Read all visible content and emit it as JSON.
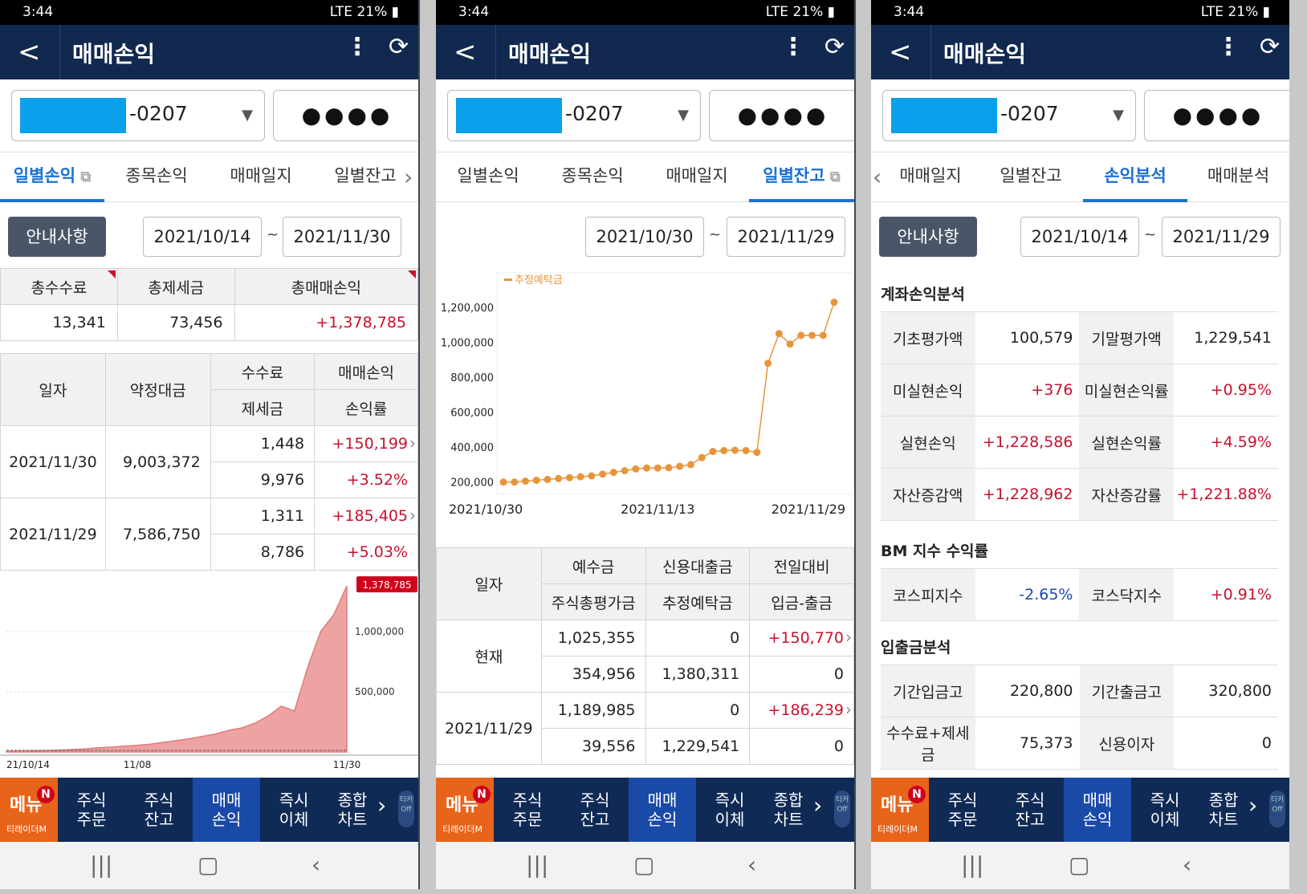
{
  "status_time": "3:44",
  "battery": "21%",
  "network": "LTE",
  "app_title": "매매손익",
  "back_glyph": "<",
  "kebab_glyph": "⋮",
  "refresh_glyph": "⟳",
  "account_suffix": "-0207",
  "password_dots": "●●●●",
  "notice_label": "안내사항",
  "tilde": "~",
  "nav": {
    "menu": "메뉴",
    "menu_badge": "N",
    "menu_sub": "티레이더M",
    "items": [
      "주식\n주문",
      "주식\n잔고",
      "매매\n손익",
      "즉시\n이체",
      "종합\n차트"
    ],
    "ticker": "티커 Off"
  },
  "p1": {
    "tabs": [
      "일별손익",
      "종목손익",
      "매매일지",
      "일별잔고"
    ],
    "date_from": "2021/10/14",
    "date_to": "2021/11/30",
    "summary_headers": [
      "총수수료",
      "총제세금",
      "총매매손익"
    ],
    "summary_values": [
      "13,341",
      "73,456",
      "+1,378,785"
    ],
    "table_headers": {
      "date": "일자",
      "amount": "약정대금",
      "fee": "수수료",
      "tax": "제세금",
      "pl": "매매손익",
      "rate": "손익률"
    },
    "rows": [
      {
        "date": "2021/11/30",
        "amount": "9,003,372",
        "fee": "1,448",
        "tax": "9,976",
        "pl": "+150,199",
        "rate": "+3.52%"
      },
      {
        "date": "2021/11/29",
        "amount": "7,586,750",
        "fee": "1,311",
        "tax": "8,786",
        "pl": "+185,405",
        "rate": "+5.03%"
      }
    ],
    "chart": {
      "last_label": "1,378,785",
      "yticks": [
        "1,000,000",
        "500,000"
      ],
      "xticks": [
        "21/10/14",
        "11/08",
        "11/30"
      ]
    }
  },
  "p2": {
    "tabs": [
      "일별손익",
      "종목손익",
      "매매일지",
      "일별잔고"
    ],
    "date_from": "2021/10/30",
    "date_to": "2021/11/29",
    "legend": "추정예탁금",
    "table_headers": {
      "date": "일자",
      "deposit": "예수금",
      "credit": "신용대출금",
      "prev": "전일대비",
      "stock_total": "주식총평가금",
      "est": "추정예탁금",
      "inout": "입금-출금"
    },
    "rows": [
      {
        "date": "현재",
        "deposit": "1,025,355",
        "credit": "0",
        "prev": "+150,770",
        "stock_total": "354,956",
        "est": "1,380,311",
        "inout": "0"
      },
      {
        "date": "2021/11/29",
        "deposit": "1,189,985",
        "credit": "0",
        "prev": "+186,239",
        "stock_total": "39,556",
        "est": "1,229,541",
        "inout": "0"
      }
    ]
  },
  "p3": {
    "tabs": [
      "매매일지",
      "일별잔고",
      "손익분석",
      "매매분석"
    ],
    "date_from": "2021/10/14",
    "date_to": "2021/11/29",
    "sec1": "계좌손익분석",
    "sec1_rows": [
      [
        "기초평가액",
        "100,579",
        "기말평가액",
        "1,229,541"
      ],
      [
        "미실현손익",
        "+376",
        "미실현손익률",
        "+0.95%"
      ],
      [
        "실현손익",
        "+1,228,586",
        "실현손익률",
        "+4.59%"
      ],
      [
        "자산증감액",
        "+1,228,962",
        "자산증감률",
        "+1,221.88%"
      ]
    ],
    "sec2": "BM 지수 수익률",
    "sec2_rows": [
      [
        "코스피지수",
        "-2.65%",
        "코스닥지수",
        "+0.91%"
      ]
    ],
    "sec3": "입출금분석",
    "sec3_rows": [
      [
        "기간입금고",
        "220,800",
        "기간출금고",
        "320,800"
      ],
      [
        "수수료+제세금",
        "75,373",
        "신용이자",
        "0"
      ]
    ]
  },
  "chart_data": [
    {
      "type": "area",
      "title": "",
      "series": [
        {
          "name": "",
          "values": [
            6000,
            7000,
            9000,
            12000,
            15000,
            20000,
            25000,
            35000,
            40000,
            48000,
            55000,
            65000,
            80000,
            95000,
            110000,
            130000,
            150000,
            180000,
            200000,
            240000,
            300000,
            380000,
            340000,
            700000,
            1000000,
            1140000,
            1378785
          ]
        }
      ],
      "x": [
        "21/10/14",
        "",
        "",
        "",
        "",
        "",
        "",
        "",
        "",
        "",
        "11/08",
        "",
        "",
        "",
        "",
        "",
        "",
        "",
        "",
        "",
        "",
        "",
        "",
        "",
        "",
        "",
        "11/30"
      ],
      "yticks": [
        500000,
        1000000
      ],
      "ylim": [
        0,
        1400000
      ]
    },
    {
      "type": "line",
      "title": "",
      "series": [
        {
          "name": "추정예탁금",
          "values": [
            200000,
            200000,
            205000,
            210000,
            215000,
            220000,
            225000,
            230000,
            235000,
            245000,
            255000,
            265000,
            275000,
            280000,
            280000,
            282000,
            290000,
            300000,
            340000,
            375000,
            380000,
            382000,
            380000,
            370000,
            880000,
            1050000,
            990000,
            1040000,
            1040000,
            1040000,
            1230000
          ]
        }
      ],
      "x": [
        "2021/10/30",
        "",
        "",
        "",
        "",
        "",
        "",
        "",
        "",
        "",
        "",
        "",
        "",
        "",
        "2021/11/13",
        "",
        "",
        "",
        "",
        "",
        "",
        "",
        "",
        "",
        "",
        "",
        "",
        "",
        "",
        "",
        "2021/11/29"
      ],
      "yticks": [
        200000,
        400000,
        600000,
        800000,
        1000000,
        1200000
      ],
      "ylim": [
        180000,
        1260000
      ]
    }
  ]
}
